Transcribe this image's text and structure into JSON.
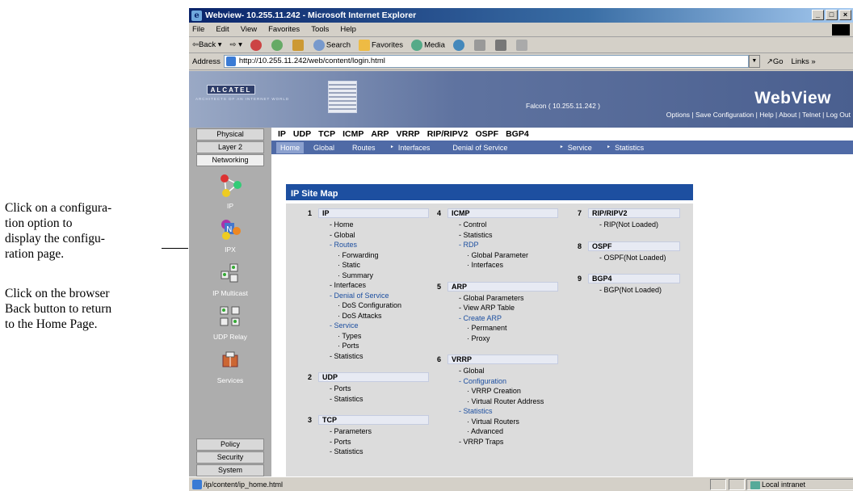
{
  "annotations": {
    "line1": "Click on a configura-",
    "line2": "tion option to",
    "line3": "display the configu-",
    "line4": "ration page.",
    "line5": "Click on the browser",
    "line6": "Back button to return",
    "line7": "to the Home Page."
  },
  "window": {
    "title": "Webview- 10.255.11.242 - Microsoft Internet Explorer",
    "min": "_",
    "max": "□",
    "close": "×"
  },
  "menu": [
    "File",
    "Edit",
    "View",
    "Favorites",
    "Tools",
    "Help"
  ],
  "toolbar": {
    "back": "⇦Back ▾",
    "forward": "⇨ ▾",
    "search": "Search",
    "favorites": "Favorites",
    "media": "Media"
  },
  "address": {
    "label": "Address",
    "url": "http://10.255.11.242/web/content/login.html",
    "go": "Go",
    "links": "Links »"
  },
  "banner": {
    "logo": "ALCATEL",
    "tagline": "ARCHITECTS OF AN INTERNET WORLD",
    "device": "Falcon  ( 10.255.11.242 )",
    "app_title": "WebView",
    "links": "Options | Save Configuration | Help | About | Telnet | Log Out"
  },
  "sidebar": {
    "tabs_top": [
      "Physical",
      "Layer 2",
      "Networking"
    ],
    "items": [
      "IP",
      "IPX",
      "IP Multicast",
      "UDP Relay",
      "Services"
    ],
    "tabs_bottom": [
      "Policy",
      "Security",
      "System"
    ]
  },
  "tabs": [
    "IP",
    "UDP",
    "TCP",
    "ICMP",
    "ARP",
    "VRRP",
    "RIP/RIPV2",
    "OSPF",
    "BGP4"
  ],
  "subnav": {
    "home": "Home",
    "global": "Global",
    "routes": "Routes",
    "interfaces": "Interfaces",
    "dos": "Denial of Service",
    "service": "Service",
    "statistics": "Statistics",
    "arrow": "‣"
  },
  "sitemap": {
    "title": "IP Site Map",
    "ip": {
      "num": "1",
      "name": "IP",
      "items": [
        "- Home",
        "- Global",
        "- Routes",
        "· Forwarding",
        "· Static",
        "· Summary",
        "- Interfaces",
        "- Denial of Service",
        "· DoS Configuration",
        "· DoS Attacks",
        "- Service",
        "· Types",
        "· Ports",
        "- Statistics"
      ]
    },
    "udp": {
      "num": "2",
      "name": "UDP",
      "items": [
        "- Ports",
        "- Statistics"
      ]
    },
    "tcp": {
      "num": "3",
      "name": "TCP",
      "items": [
        "- Parameters",
        "- Ports",
        "- Statistics"
      ]
    },
    "icmp": {
      "num": "4",
      "name": "ICMP",
      "items": [
        "- Control",
        "- Statistics",
        "- RDP",
        "· Global Parameter",
        "· Interfaces"
      ]
    },
    "arp": {
      "num": "5",
      "name": "ARP",
      "items": [
        "- Global Parameters",
        "- View ARP Table",
        "- Create ARP",
        "· Permanent",
        "· Proxy"
      ]
    },
    "vrrp": {
      "num": "6",
      "name": "VRRP",
      "items": [
        "- Global",
        "- Configuration",
        "· VRRP Creation",
        "· Virtual Router Address",
        "- Statistics",
        "· Virtual Routers",
        "· Advanced",
        "- VRRP Traps"
      ]
    },
    "rip": {
      "num": "7",
      "name": "RIP/RIPV2",
      "items": [
        "- RIP(Not Loaded)"
      ]
    },
    "ospf": {
      "num": "8",
      "name": "OSPF",
      "items": [
        "- OSPF(Not Loaded)"
      ]
    },
    "bgp": {
      "num": "9",
      "name": "BGP4",
      "items": [
        "- BGP(Not Loaded)"
      ]
    }
  },
  "status": {
    "url": "/ip/content/ip_home.html",
    "zone": "Local intranet"
  }
}
